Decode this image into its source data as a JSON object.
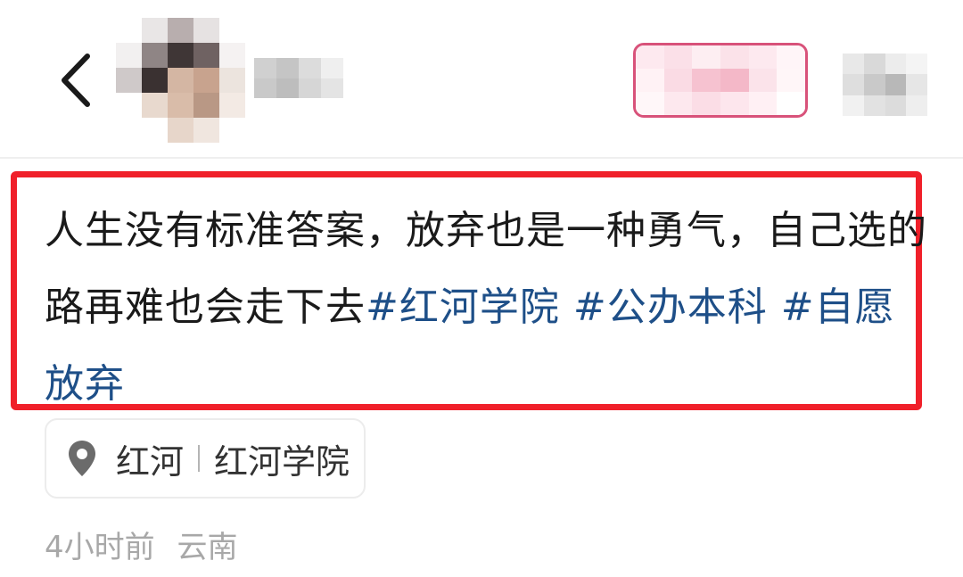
{
  "post": {
    "text": "人生没有标准答案，放弃也是一种勇气，自己选的路再难也会走下去",
    "hashtags": [
      "#红河学院",
      "#公办本科",
      "#自愿放弃"
    ]
  },
  "location": {
    "city": "红河",
    "place": "红河学院"
  },
  "meta": {
    "time": "4小时前",
    "region": "云南"
  },
  "icons": {
    "back": "chevron-left-icon",
    "location": "location-pin-icon"
  },
  "colors": {
    "hashtag": "#1e4f88",
    "highlight_border": "#f0202a",
    "follow_border": "#d8527a",
    "meta_text": "#a8a8a8"
  }
}
